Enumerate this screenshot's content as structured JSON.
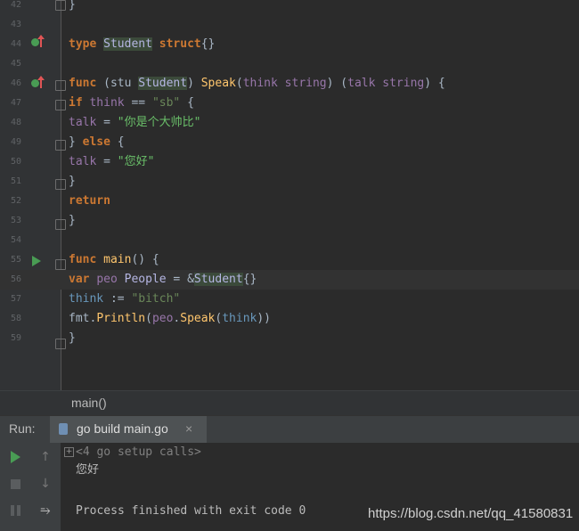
{
  "editor": {
    "lines": [
      {
        "num": "42",
        "code": [
          {
            "t": "}",
            "c": ""
          }
        ]
      },
      {
        "num": "43",
        "code": []
      },
      {
        "num": "44",
        "code": [
          {
            "t": "type",
            "c": "kw"
          },
          {
            "t": " ",
            "c": ""
          },
          {
            "t": "Student",
            "c": "tyh"
          },
          {
            "t": " ",
            "c": ""
          },
          {
            "t": "struct",
            "c": "kw"
          },
          {
            "t": "{}",
            "c": ""
          }
        ]
      },
      {
        "num": "45",
        "code": []
      },
      {
        "num": "46",
        "code": [
          {
            "t": "func",
            "c": "kw"
          },
          {
            "t": " (stu ",
            "c": ""
          },
          {
            "t": "Student",
            "c": "tyh"
          },
          {
            "t": ") ",
            "c": ""
          },
          {
            "t": "Speak",
            "c": "fn"
          },
          {
            "t": "(",
            "c": ""
          },
          {
            "t": "think",
            "c": "prm"
          },
          {
            "t": " ",
            "c": ""
          },
          {
            "t": "string",
            "c": "prm"
          },
          {
            "t": ") (",
            "c": ""
          },
          {
            "t": "talk",
            "c": "prm"
          },
          {
            "t": " ",
            "c": ""
          },
          {
            "t": "string",
            "c": "prm"
          },
          {
            "t": ") {",
            "c": ""
          }
        ]
      },
      {
        "num": "47",
        "code": [
          {
            "t": "if",
            "c": "kw"
          },
          {
            "t": " ",
            "c": ""
          },
          {
            "t": "think",
            "c": "prm"
          },
          {
            "t": " == ",
            "c": ""
          },
          {
            "t": "\"sb\"",
            "c": "str"
          },
          {
            "t": " {",
            "c": ""
          }
        ]
      },
      {
        "num": "48",
        "code": [
          {
            "t": "talk",
            "c": "prm"
          },
          {
            "t": " = ",
            "c": ""
          },
          {
            "t": "\"你是个大帅比\"",
            "c": "strz"
          }
        ]
      },
      {
        "num": "49",
        "code": [
          {
            "t": "} ",
            "c": ""
          },
          {
            "t": "else",
            "c": "kw"
          },
          {
            "t": " {",
            "c": ""
          }
        ]
      },
      {
        "num": "50",
        "code": [
          {
            "t": "talk",
            "c": "prm"
          },
          {
            "t": " = ",
            "c": ""
          },
          {
            "t": "\"您好\"",
            "c": "strz"
          }
        ]
      },
      {
        "num": "51",
        "code": [
          {
            "t": "}",
            "c": ""
          }
        ]
      },
      {
        "num": "52",
        "code": [
          {
            "t": "return",
            "c": "kw"
          }
        ]
      },
      {
        "num": "53",
        "code": [
          {
            "t": "}",
            "c": ""
          }
        ]
      },
      {
        "num": "54",
        "code": []
      },
      {
        "num": "55",
        "code": [
          {
            "t": "func",
            "c": "kw"
          },
          {
            "t": " ",
            "c": ""
          },
          {
            "t": "main",
            "c": "fn"
          },
          {
            "t": "() {",
            "c": ""
          }
        ]
      },
      {
        "num": "56",
        "code": [
          {
            "t": "var",
            "c": "kw"
          },
          {
            "t": " ",
            "c": ""
          },
          {
            "t": "peo",
            "c": "var"
          },
          {
            "t": " ",
            "c": ""
          },
          {
            "t": "People",
            "c": "ty"
          },
          {
            "t": " = &",
            "c": ""
          },
          {
            "t": "Student",
            "c": "tyh"
          },
          {
            "t": "{}",
            "c": ""
          }
        ]
      },
      {
        "num": "57",
        "code": [
          {
            "t": "think",
            "c": "lvar"
          },
          {
            "t": " := ",
            "c": ""
          },
          {
            "t": "\"bitch\"",
            "c": "str"
          }
        ]
      },
      {
        "num": "58",
        "code": [
          {
            "t": "fmt",
            "c": ""
          },
          {
            "t": ".",
            "c": ""
          },
          {
            "t": "Println",
            "c": "fn"
          },
          {
            "t": "(",
            "c": ""
          },
          {
            "t": "peo",
            "c": "var"
          },
          {
            "t": ".",
            "c": ""
          },
          {
            "t": "Speak",
            "c": "fn"
          },
          {
            "t": "(",
            "c": ""
          },
          {
            "t": "think",
            "c": "lvar"
          },
          {
            "t": "))",
            "c": ""
          }
        ]
      },
      {
        "num": "59",
        "code": [
          {
            "t": "}",
            "c": ""
          }
        ]
      }
    ]
  },
  "breadcrumb": {
    "label": "main()"
  },
  "run_panel": {
    "label": "Run:",
    "tab_label": "go build main.go",
    "close_glyph": "×"
  },
  "console": {
    "setup_calls": "<4 go setup calls>",
    "output": "您好",
    "exit_message": "Process finished with exit code 0"
  },
  "watermark": "https://blog.csdn.net/qq_41580831"
}
